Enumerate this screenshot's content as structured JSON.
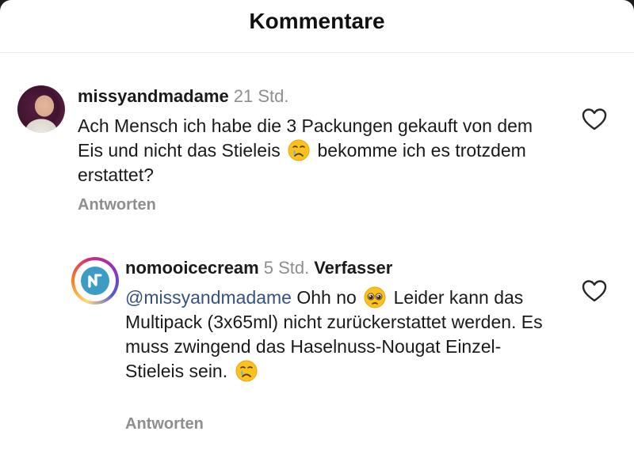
{
  "header": {
    "title": "Kommentare"
  },
  "comments": [
    {
      "username": "missyandmadame",
      "time": "21 Std.",
      "text_before_emoji": "Ach Mensch ich habe die 3 Packungen gekauft von dem Eis und nicht das Stieleis",
      "emoji": "crying-face-icon",
      "text_after_emoji": "bekomme ich es trotzdem erstattet?",
      "reply_label": "Antworten"
    },
    {
      "username": "nomooicecream",
      "time": "5 Std.",
      "author_badge": "Verfasser",
      "mention": "@missyandmadame",
      "text_part1": "Ohh no",
      "emoji1": "pleading-face-icon",
      "text_part2": "Leider kann das Multipack (3x65ml) nicht zurückerstattet werden. Es muss zwingend das Haselnuss-Nougat Einzel-Stieleis sein.",
      "emoji2": "crying-face-icon",
      "reply_label": "Antworten"
    }
  ],
  "colors": {
    "accent_mention": "#385185",
    "meta_gray": "#8e8e8e",
    "logo_blue": "#3d9cc3"
  }
}
